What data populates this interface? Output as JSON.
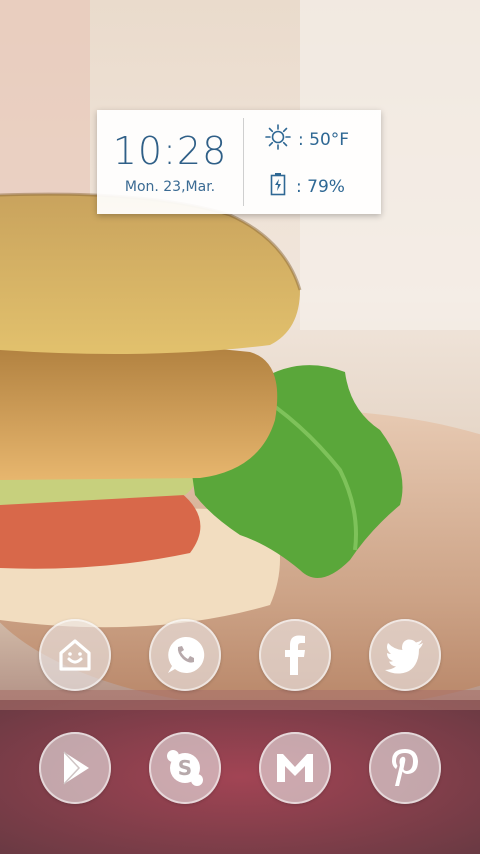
{
  "widget": {
    "time": "10:28",
    "date": "Mon. 23,Mar.",
    "weather_icon": "sun-icon",
    "temperature": ": 50°F",
    "battery_icon": "battery-charging-icon",
    "battery": ": 79%",
    "accent_color": "#2f6894"
  },
  "apps": [
    {
      "name": "launcher-home",
      "icon": "smiley-home-icon"
    },
    {
      "name": "whatsapp",
      "icon": "whatsapp-icon"
    },
    {
      "name": "facebook",
      "icon": "facebook-icon"
    },
    {
      "name": "twitter",
      "icon": "twitter-bird-icon"
    },
    {
      "name": "play-store",
      "icon": "play-store-icon"
    },
    {
      "name": "skype",
      "icon": "skype-icon"
    },
    {
      "name": "gmail",
      "icon": "gmail-m-icon"
    },
    {
      "name": "pinterest",
      "icon": "pinterest-icon"
    }
  ]
}
